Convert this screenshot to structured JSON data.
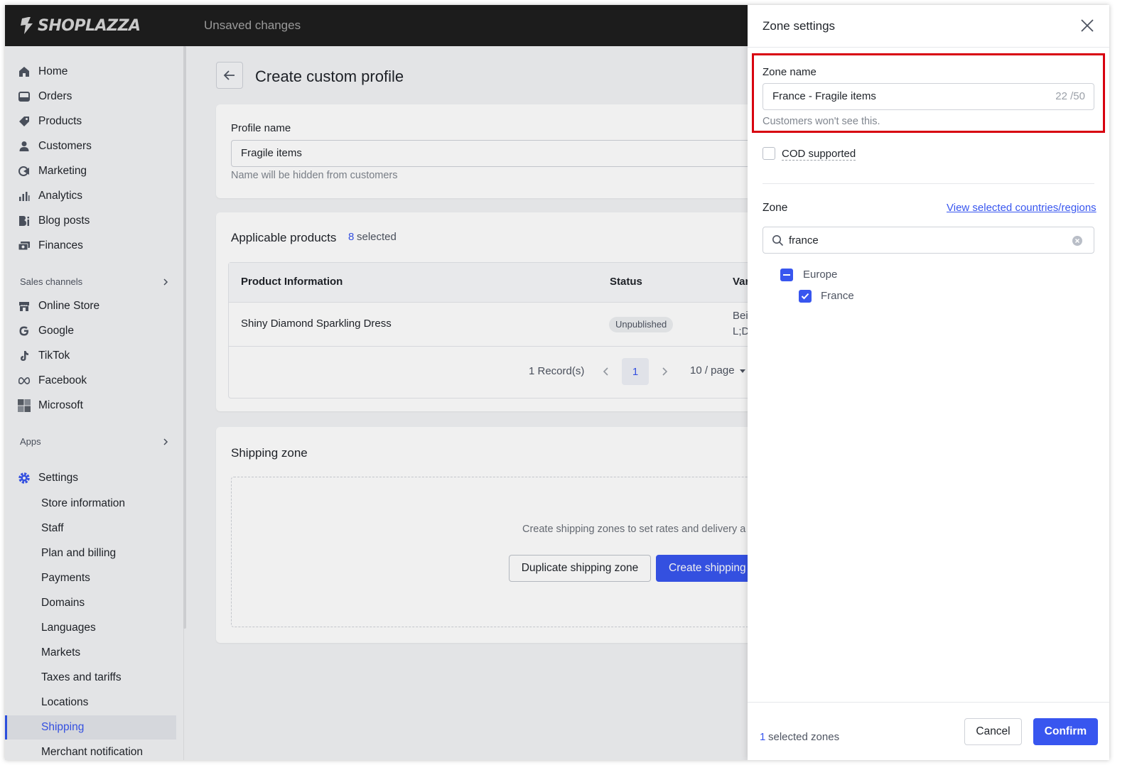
{
  "app": {
    "logo_text": "SHOPLAZZA",
    "status": "Unsaved changes"
  },
  "sidebar": {
    "items": [
      {
        "label": "Home",
        "icon": "home-icon"
      },
      {
        "label": "Orders",
        "icon": "inbox-icon"
      },
      {
        "label": "Products",
        "icon": "tag-icon"
      },
      {
        "label": "Customers",
        "icon": "person-icon"
      },
      {
        "label": "Marketing",
        "icon": "megaphone-icon"
      },
      {
        "label": "Analytics",
        "icon": "bar-chart-icon"
      },
      {
        "label": "Blog posts",
        "icon": "blog-icon"
      },
      {
        "label": "Finances",
        "icon": "finance-icon"
      }
    ],
    "sales_channels_label": "Sales channels",
    "channels": [
      {
        "label": "Online Store",
        "icon": "store-icon"
      },
      {
        "label": "Google",
        "icon": "google-icon"
      },
      {
        "label": "TikTok",
        "icon": "tiktok-icon"
      },
      {
        "label": "Facebook",
        "icon": "meta-icon"
      },
      {
        "label": "Microsoft",
        "icon": "microsoft-icon"
      }
    ],
    "apps_label": "Apps",
    "settings_label": "Settings",
    "settings_items": [
      "Store information",
      "Staff",
      "Plan and billing",
      "Payments",
      "Domains",
      "Languages",
      "Markets",
      "Taxes and tariffs",
      "Locations",
      "Shipping",
      "Merchant notification"
    ],
    "active_settings_item": "Shipping"
  },
  "main": {
    "title": "Create custom profile",
    "profile": {
      "label": "Profile name",
      "value": "Fragile items",
      "hint": "Name will be hidden from customers"
    },
    "products": {
      "title": "Applicable products",
      "selected_count": "8",
      "selected_suffix": "selected",
      "columns": [
        "Product Information",
        "Status",
        "Var"
      ],
      "rows": [
        {
          "name": "Shiny Diamond Sparkling Dress",
          "status": "Unpublished",
          "variant_line1": "Bei",
          "variant_line2": "L;D"
        }
      ],
      "records": "1 Record(s)",
      "page": "1",
      "page_size": "10 / page"
    },
    "shipping_zone": {
      "title": "Shipping zone",
      "empty_text": "Create shipping zones to set rates and delivery a",
      "duplicate_label": "Duplicate shipping zone",
      "create_label": "Create shipping"
    }
  },
  "drawer": {
    "title": "Zone settings",
    "zone_name_label": "Zone name",
    "zone_name_value": "France - Fragile items",
    "char_count": "22 /50",
    "zone_name_hint": "Customers won't see this.",
    "cod_label": "COD supported",
    "cod_checked": false,
    "zone_label": "Zone",
    "view_link": "View selected countries/regions",
    "search_value": "france",
    "tree": {
      "region": "Europe",
      "region_state": "partial",
      "country": "France",
      "country_checked": true
    },
    "footer": {
      "count": "1",
      "count_suffix": "selected zones",
      "cancel_label": "Cancel",
      "confirm_label": "Confirm"
    }
  },
  "colors": {
    "accent": "#3856ef",
    "highlight": "#d8000f",
    "topbar": "#1c1c1c"
  }
}
